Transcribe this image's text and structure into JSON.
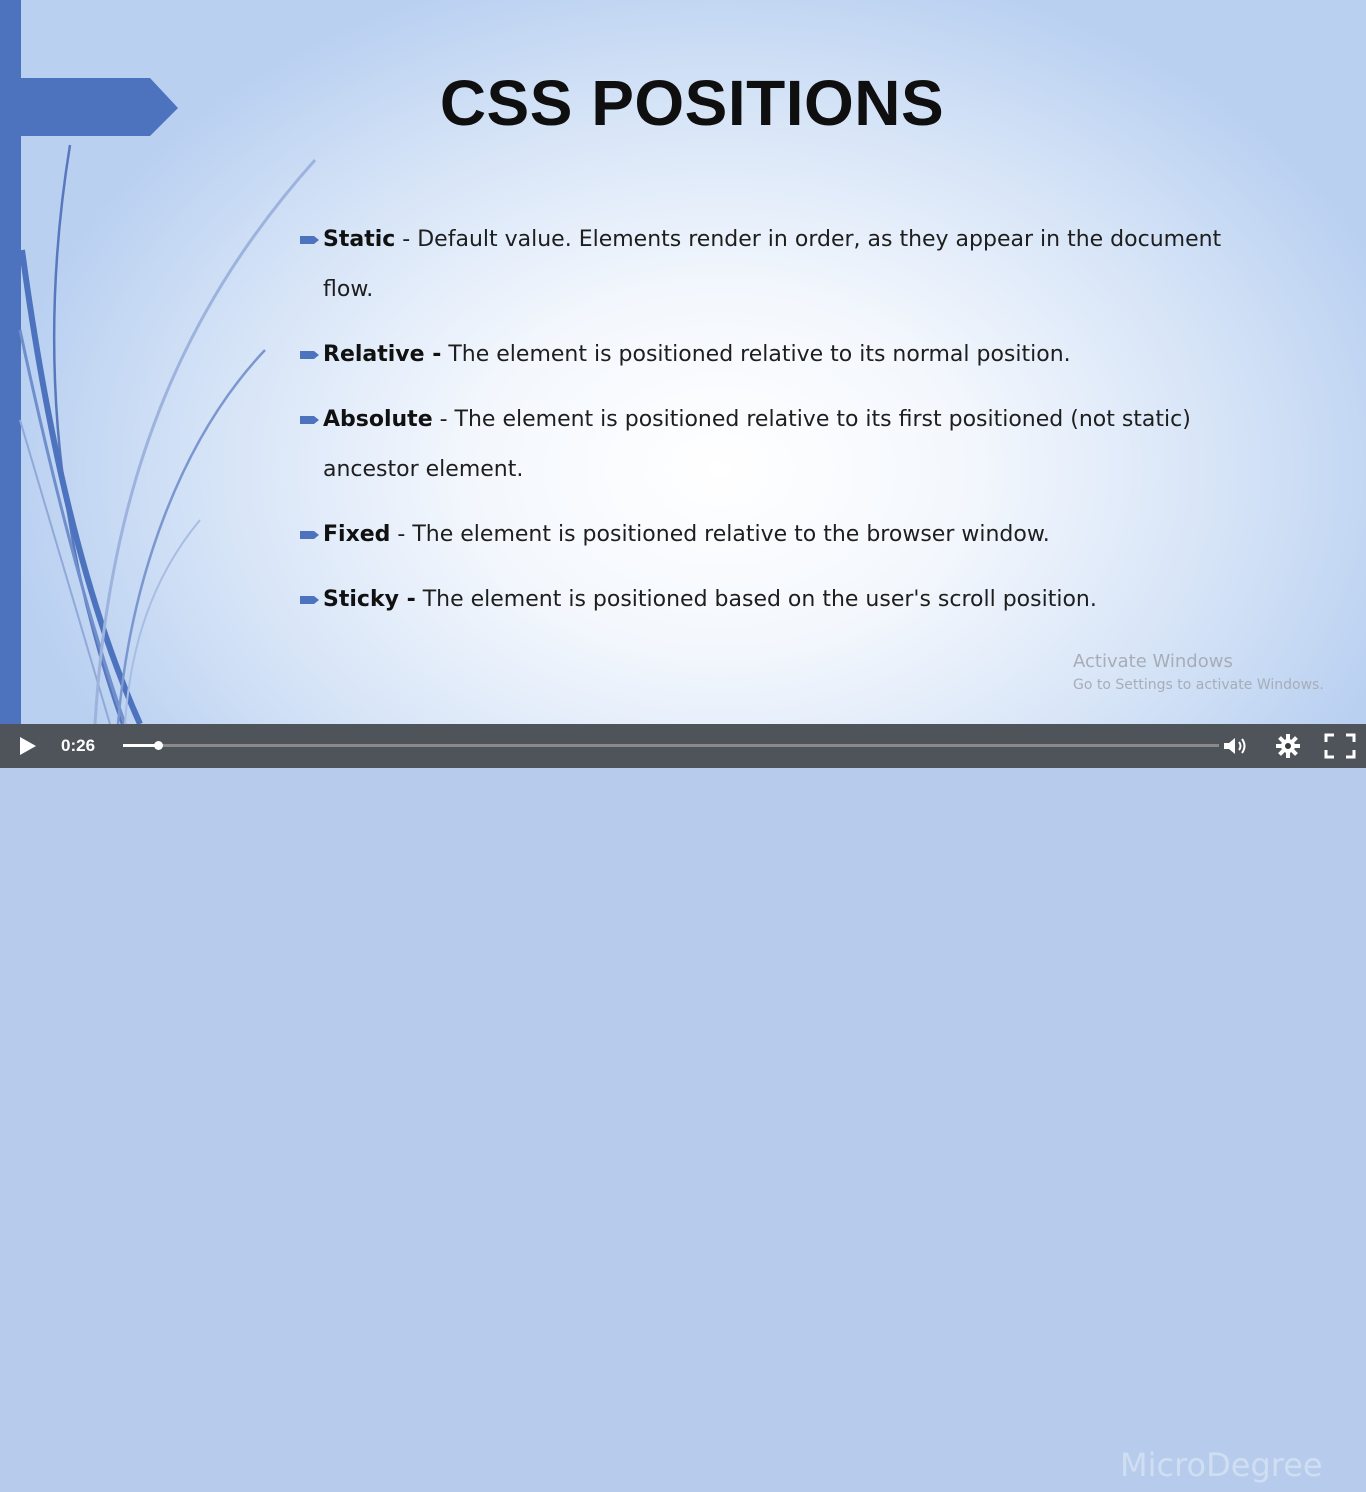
{
  "slide": {
    "title": "CSS POSITIONS",
    "bullets": [
      {
        "term": "Static",
        "text": " - Default value. Elements render in order, as they appear in the document flow."
      },
      {
        "term": "Relative -",
        "text": " The element is positioned relative to its normal position."
      },
      {
        "term": "Absolute",
        "text": " - The element is positioned relative to its first positioned (not static) ancestor element."
      },
      {
        "term": "Fixed",
        "text": " - The element is positioned relative to the browser window."
      },
      {
        "term": "Sticky -",
        "text": " The element is positioned based on the user's scroll position."
      }
    ]
  },
  "watermark": {
    "activate_title": "Activate Windows",
    "activate_subtitle": "Go to Settings to activate Windows.",
    "brand_text": "MicroDegree"
  },
  "player": {
    "time": "0:26",
    "progress": 0.032,
    "play_icon": "play-icon",
    "volume_icon": "volume-icon",
    "settings_icon": "gear-icon",
    "fullscreen_icon": "fullscreen-icon"
  },
  "colors": {
    "accent": "#4d72be",
    "title": "#0f0f0f",
    "text": "#1e1e1e",
    "controls_bg": "#323232"
  }
}
